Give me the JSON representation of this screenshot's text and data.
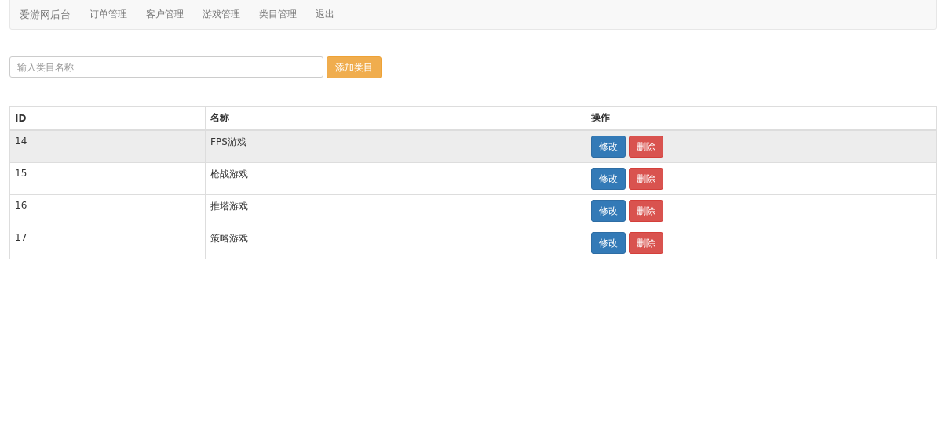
{
  "navbar": {
    "brand": "爱游网后台",
    "items": [
      "订单管理",
      "客户管理",
      "游戏管理",
      "类目管理",
      "退出"
    ]
  },
  "add_form": {
    "placeholder": "输入类目名称",
    "button": "添加类目"
  },
  "table": {
    "columns": [
      "ID",
      "名称",
      "操作"
    ],
    "rows": [
      {
        "id": "14",
        "name": "FPS游戏",
        "edit": "修改",
        "delete": "删除",
        "hovered": true
      },
      {
        "id": "15",
        "name": "枪战游戏",
        "edit": "修改",
        "delete": "删除",
        "hovered": false
      },
      {
        "id": "16",
        "name": "推塔游戏",
        "edit": "修改",
        "delete": "删除",
        "hovered": false
      },
      {
        "id": "17",
        "name": "策略游戏",
        "edit": "修改",
        "delete": "删除",
        "hovered": false
      }
    ]
  }
}
